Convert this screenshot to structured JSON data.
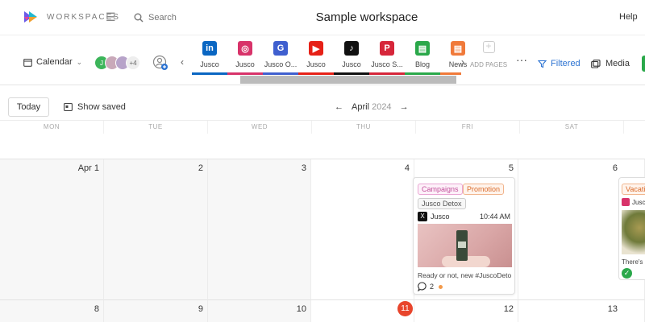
{
  "topbar": {
    "brand": "WORKSPACES",
    "search_placeholder": "Search",
    "title": "Sample workspace",
    "help": "Help"
  },
  "toolbar": {
    "calendar_label": "Calendar",
    "avatar_initial": "J",
    "avatar_more": "+4",
    "pages": [
      {
        "label": "Jusco",
        "icon": "linkedin-icon",
        "glyph": "in",
        "color": "#0a66c2"
      },
      {
        "label": "Jusco",
        "icon": "instagram-icon",
        "glyph": "◎",
        "color": "#d8336a"
      },
      {
        "label": "Jusco O...",
        "icon": "google-icon",
        "glyph": "G",
        "color": "#3f5fcf"
      },
      {
        "label": "Jusco",
        "icon": "youtube-icon",
        "glyph": "▶",
        "color": "#e62117"
      },
      {
        "label": "Jusco",
        "icon": "tiktok-icon",
        "glyph": "♪",
        "color": "#111111"
      },
      {
        "label": "Jusco S...",
        "icon": "pinterest-icon",
        "glyph": "P",
        "color": "#d6263a"
      },
      {
        "label": "Blog",
        "icon": "blog-icon",
        "glyph": "▤",
        "color": "#2aa84a"
      },
      {
        "label": "News",
        "icon": "news-icon",
        "glyph": "▤",
        "color": "#f07a3a"
      }
    ],
    "add_pages": "ADD PAGES",
    "filtered": "Filtered",
    "media": "Media"
  },
  "calendar": {
    "today": "Today",
    "show_saved": "Show saved",
    "month": "April",
    "year": "2024",
    "weekdays": [
      "MON",
      "TUE",
      "WED",
      "THU",
      "FRI",
      "SAT"
    ],
    "week1": [
      "Apr 1",
      "2",
      "3",
      "4",
      "5",
      "6"
    ],
    "week2": [
      "8",
      "9",
      "10",
      "11",
      "12",
      "13"
    ]
  },
  "post": {
    "tags": [
      "Campaigns",
      "Promotion",
      "Jusco Detox"
    ],
    "account": "Jusco",
    "time": "10:44 AM",
    "caption": "Ready or not, new #JuscoDeto...",
    "comments": "2"
  },
  "post2": {
    "tag": "Vacation",
    "account": "Jusco",
    "caption": "There's"
  },
  "colors": {
    "accent": "#2c73d2",
    "today": "#e8452c",
    "approved": "#2aa84a"
  }
}
